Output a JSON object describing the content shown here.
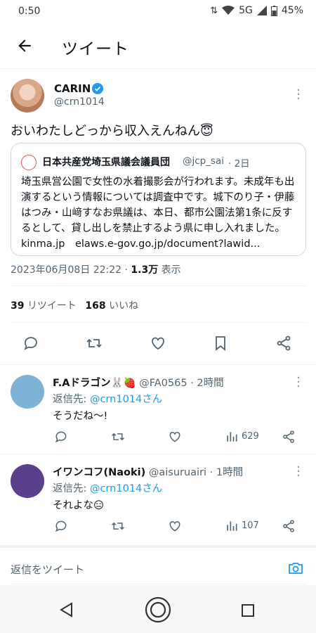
{
  "status_bar": {
    "time": "0:50",
    "network": "5G",
    "battery": "45%"
  },
  "header": {
    "title": "ツイート"
  },
  "tweet": {
    "display_name": "CARIN",
    "handle": "@crn1014",
    "text": "おいわたしどっから収入えんねん😇",
    "quote": {
      "display_name": "日本共産党埼玉県議会議員団",
      "handle": "@jcp_sai",
      "time": "· 2日",
      "text": "埼玉県営公園で女性の水着撮影会が行われます。未成年も出演するという情報については調査中です。城下のり子・伊藤はつみ・山﨑すなお県議は、本日、都市公園法第1条に反するとして、貸し出しを禁止するよう県に申し入れました。kinma.jp　elaws.e-gov.go.jp/document?lawid..."
    },
    "timestamp": "2023年06月08日 22:22 · ",
    "views_count": "1.3万",
    "views_label": " 表示",
    "retweets_count": "39",
    "retweets_label": "リツイート",
    "likes_count": "168",
    "likes_label": "いいね"
  },
  "replies": [
    {
      "display_name": "F.Aドラゴン🐰🍓",
      "handle": "@FA0565",
      "time": "· 2時間",
      "reply_to_label": "返信先: ",
      "reply_to": "@crn1014さん",
      "text": "そうだね〜!",
      "views": "629",
      "avatar_color": "#7fb3d5"
    },
    {
      "display_name": "イワンコフ(Naoki)",
      "handle": "@aisuruairi",
      "time": "· 1時間",
      "reply_to_label": "返信先: ",
      "reply_to": "@crn1014さん",
      "text": "それよな😑",
      "views": "107",
      "avatar_color": "#5a3f8c"
    }
  ],
  "composer": {
    "placeholder": "返信をツイート"
  },
  "colors": {
    "accent": "#1d9bf0",
    "text": "#0f1419",
    "muted": "#536471",
    "border": "#cfd9de"
  }
}
